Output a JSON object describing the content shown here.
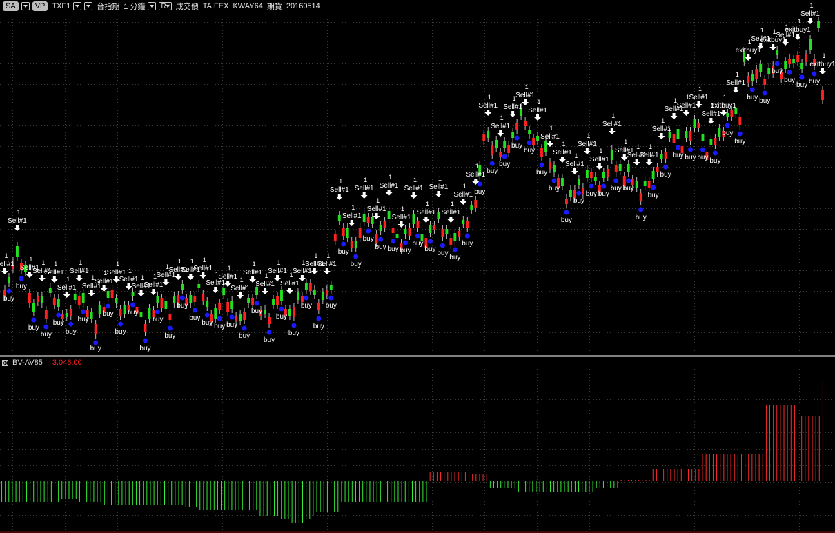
{
  "toolbar": {
    "sa_label": "SA",
    "vp_label": "VP",
    "symbol": "TXF1",
    "symbol_name": "台指期",
    "interval": "1 分鐘",
    "r_label": "R",
    "price_type": "成交價",
    "exchange": "TAIFEX",
    "strategy": "KWAY64",
    "market": "期貨",
    "date": "20160514"
  },
  "sub_panel": {
    "title": "BV-AV85",
    "value": "3,046.00"
  },
  "colors": {
    "background": "#000000",
    "up": "#ff2020",
    "down": "#20e020",
    "buy_marker": "#1a1aff",
    "signal_text": "#ffffff",
    "separator": "#ffffff"
  },
  "chart_data": {
    "type": "candlestick",
    "closes": [
      420,
      410,
      378,
      372,
      382,
      395,
      425,
      452,
      430,
      440,
      450,
      425,
      432,
      445,
      455,
      460,
      448,
      435,
      430,
      440,
      450,
      462,
      470,
      455,
      445,
      432,
      420,
      440,
      448,
      455,
      442,
      430,
      445,
      460,
      470,
      462,
      450,
      440,
      432,
      448,
      456,
      440,
      428,
      420,
      432,
      440,
      430,
      418,
      426,
      445,
      455,
      462,
      440,
      428,
      438,
      448,
      458,
      465,
      452,
      440,
      432,
      428,
      450,
      455,
      460,
      442,
      430,
      436,
      448,
      458,
      445,
      435,
      430,
      420,
      410,
      428,
      440,
      435,
      420,
      420,
      340,
      320,
      330,
      345,
      350,
      360,
      330,
      322,
      315,
      325,
      340,
      335,
      320,
      318,
      330,
      345,
      352,
      340,
      330,
      325,
      320,
      350,
      345,
      338,
      326,
      318,
      332,
      340,
      345,
      350,
      335,
      325,
      320,
      305,
      290,
      255,
      195,
      200,
      210,
      215,
      220,
      215,
      210,
      200,
      178,
      168,
      175,
      195,
      200,
      205,
      215,
      220,
      235,
      250,
      258,
      270,
      288,
      285,
      275,
      268,
      272,
      258,
      250,
      262,
      268,
      258,
      245,
      232,
      240,
      248,
      255,
      250,
      260,
      272,
      280,
      270,
      262,
      260,
      242,
      230,
      220,
      200,
      195,
      202,
      212,
      200,
      190,
      185,
      178,
      205,
      220,
      210,
      200,
      198,
      190,
      170,
      160,
      165,
      170,
      90,
      110,
      118,
      100,
      105,
      115,
      108,
      95,
      80,
      105,
      100,
      85,
      92,
      80,
      100,
      78,
      72,
      85,
      40,
      130
    ],
    "open_offsets": [
      10,
      -8,
      12,
      -15,
      10,
      -10,
      15,
      -12,
      8,
      -10,
      12,
      -8,
      10,
      -12,
      8,
      -6
    ],
    "sell_label": "Sell#1",
    "buy_label": "buy",
    "exit_label": "exitbuy1",
    "qty_label": "1",
    "volume": [
      -30,
      -30,
      -30,
      -30,
      -30,
      -30,
      -30,
      -30,
      -30,
      -30,
      -30,
      -30,
      -30,
      -30,
      -30,
      -30,
      -30,
      -25,
      -25,
      -25,
      -25,
      -25,
      -30,
      -30,
      -30,
      -30,
      -30,
      -30,
      -30,
      -35,
      -35,
      -35,
      -35,
      -35,
      -35,
      -35,
      -35,
      -35,
      -35,
      -35,
      -35,
      -35,
      -35,
      -35,
      -35,
      -35,
      -35,
      -35,
      -35,
      -35,
      -35,
      -35,
      -38,
      -38,
      -38,
      -38,
      -42,
      -42,
      -42,
      -42,
      -42,
      -42,
      -42,
      -42,
      -42,
      -42,
      -42,
      -42,
      -42,
      -42,
      -42,
      -42,
      -42,
      -50,
      -50,
      -50,
      -50,
      -50,
      -50,
      -55,
      -55,
      -55,
      -60,
      -60,
      -60,
      -60,
      -55,
      -55,
      -50,
      -45,
      -45,
      -45,
      -45,
      -45,
      -45,
      -45,
      -30,
      -30,
      -30,
      -30,
      -30,
      -30,
      -30,
      -30,
      -30,
      -30,
      -30,
      -30,
      -30,
      -30,
      -30,
      -30,
      -30,
      -30,
      -30,
      -30,
      -30,
      -30,
      -30,
      -30,
      -30,
      14,
      14,
      14,
      14,
      14,
      14,
      14,
      14,
      14,
      14,
      14,
      14,
      10,
      10,
      10,
      10,
      10,
      -10,
      -10,
      -10,
      -10,
      -10,
      -10,
      -10,
      -10,
      -15,
      -15,
      -15,
      -15,
      -15,
      -15,
      -15,
      -15,
      -15,
      -15,
      -15,
      -15,
      -15,
      -15,
      -15,
      -15,
      -15,
      -15,
      -15,
      -15,
      -15,
      -15,
      -10,
      -10,
      -10,
      -10,
      -10,
      -10,
      -10,
      2,
      2,
      2,
      2,
      2,
      2,
      2,
      2,
      2,
      18,
      18,
      18,
      18,
      18,
      18,
      18,
      18,
      18,
      18,
      18,
      18,
      18,
      18,
      40,
      40,
      40,
      40,
      40,
      40,
      40,
      40,
      40,
      40,
      40,
      40,
      40,
      40,
      40,
      40,
      40,
      40,
      110,
      110,
      110,
      110,
      110,
      110,
      110,
      110,
      110,
      95,
      95,
      95,
      95,
      95,
      95,
      95,
      145
    ]
  }
}
